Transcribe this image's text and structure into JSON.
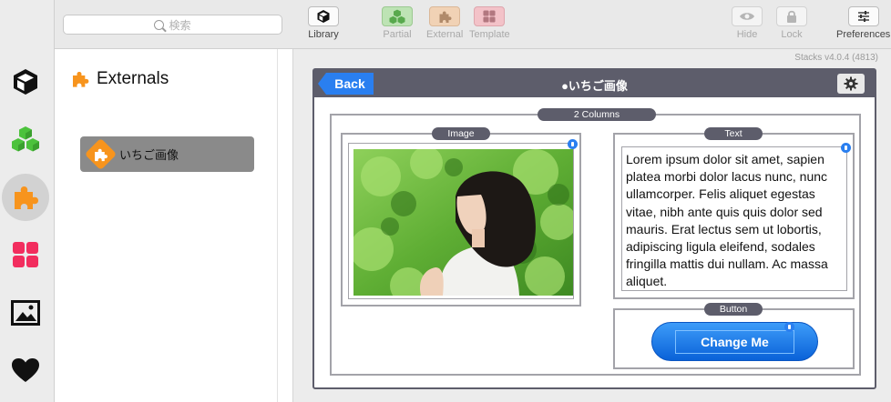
{
  "search": {
    "placeholder": "検索"
  },
  "sidebar": {
    "title": "Externals",
    "items": [
      {
        "label": "いちご画像"
      }
    ]
  },
  "rail": {
    "icons": [
      "cube-icon",
      "partials-cubes-icon",
      "puzzle-icon",
      "templates-grid-icon",
      "image-icon",
      "heart-icon"
    ],
    "active": "puzzle-icon"
  },
  "toolbar": {
    "library_label": "Library",
    "partial_label": "Partial",
    "external_label": "External",
    "template_label": "Template",
    "hide_label": "Hide",
    "lock_label": "Lock",
    "preferences_label": "Preferences"
  },
  "version": "Stacks v4.0.4 (4813)",
  "editor": {
    "back_label": "Back",
    "title": "●いちご画像",
    "columns_label": "2 Columns",
    "image_label": "Image",
    "text_label": "Text",
    "button_label": "Button",
    "body_text": "Lorem ipsum dolor sit amet, sapien platea morbi dolor lacus nunc, nunc ullamcorper. Felis aliquet egestas vitae, nibh ante quis quis dolor sed mauris. Erat lectus sem ut lobortis, adipiscing ligula eleifend, sodales fringilla mattis dui nullam. Ac massa aliquet.",
    "change_button": "Change Me"
  },
  "colors": {
    "accent_blue": "#2a7ff0",
    "editor_dark": "#5d5d6b",
    "external_orange": "#f7941d",
    "partial_green": "#4cc23c",
    "template_pink": "#f22d5e"
  }
}
